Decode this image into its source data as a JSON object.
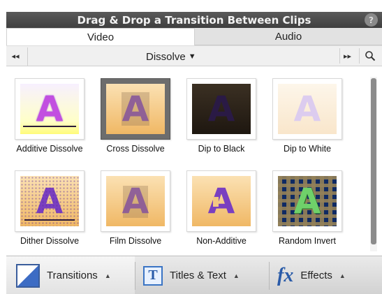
{
  "panel": {
    "title": "Drag & Drop a Transition Between Clips",
    "help_symbol": "?"
  },
  "tabs": [
    {
      "label": "Video",
      "active": true
    },
    {
      "label": "Audio",
      "active": false
    }
  ],
  "nav": {
    "prev_symbol": "◂◂",
    "next_symbol": "▸▸",
    "category": "Dissolve",
    "dropdown_symbol": "▼"
  },
  "transitions": [
    {
      "label": "Additive Dissolve",
      "letter": "A"
    },
    {
      "label": "Cross Dissolve",
      "letter": "A",
      "selected": true
    },
    {
      "label": "Dip to Black",
      "letter": "A"
    },
    {
      "label": "Dip to White",
      "letter": "A"
    },
    {
      "label": "Dither Dissolve",
      "letter": "A"
    },
    {
      "label": "Film Dissolve",
      "letter": "A"
    },
    {
      "label": "Non-Additive",
      "letter": "A"
    },
    {
      "label": "Random Invert",
      "letter": "A"
    }
  ],
  "bottom_bar": {
    "transitions_label": "Transitions",
    "titles_label": "Titles & Text",
    "titles_icon_letter": "T",
    "effects_label": "Effects",
    "effects_icon_text": "fx",
    "caret": "▲"
  },
  "colors": {
    "accent_purple": "#7a3fc0",
    "thumb_gold": "#f0c27a",
    "titlebar": "#4a4a4a"
  }
}
